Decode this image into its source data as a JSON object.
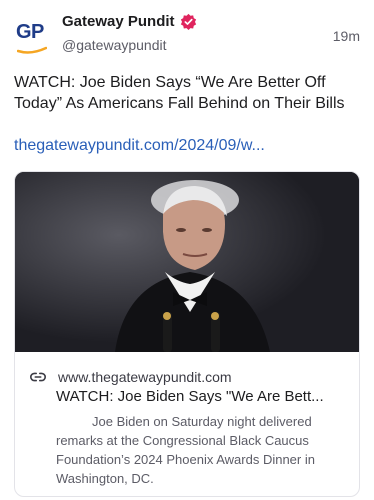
{
  "account": {
    "avatar_text": "GP",
    "display_name": "Gateway Pundit",
    "handle": "@gatewaypundit",
    "verified_icon": "verified-badge-icon",
    "time": "19m"
  },
  "post": {
    "text": "WATCH: Joe Biden Says “We Are Better Off Today” As Americans Fall Behind on Their Bills",
    "link_text": "thegatewaypundit.com/2024/09/w..."
  },
  "card": {
    "image": "photo-man-in-tuxedo-at-podium",
    "link_icon": "link-icon",
    "domain": "www.thegatewaypundit.com",
    "title": "WATCH: Joe Biden Says \"We Are Bett...",
    "description": "Joe Biden on Saturday night delivered remarks at the Congressional Black Caucus Foundation’s 2024 Phoenix Awards Dinner in Washington, DC."
  },
  "colors": {
    "brand_blue": "#1f3c88",
    "brand_gold": "#f5a623",
    "verified_pink": "#e0245e",
    "link_blue": "#2a5fb8"
  }
}
